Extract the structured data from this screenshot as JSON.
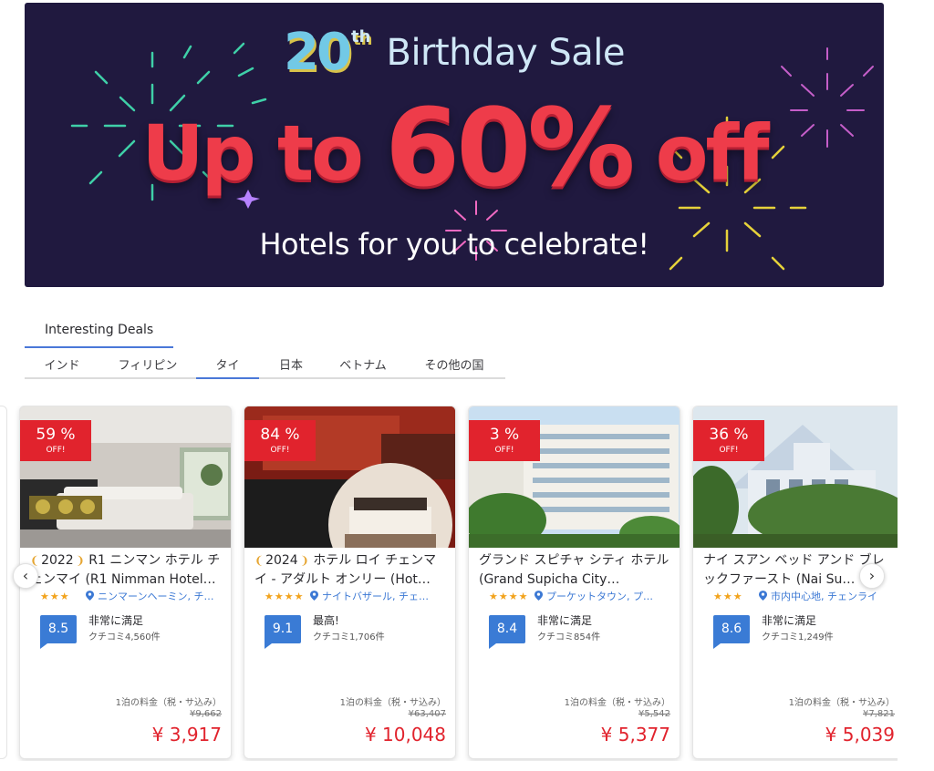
{
  "banner": {
    "number": "20",
    "suffix": "th",
    "title": "Birthday Sale",
    "headline_1": "Up to ",
    "headline_2": "60%",
    "headline_3": " off",
    "subtitle": "Hotels for you to celebrate!"
  },
  "tabs": {
    "section": "Interesting Deals",
    "countries": [
      "インド",
      "フィリピン",
      "タイ",
      "日本",
      "ベトナム",
      "その他の国"
    ],
    "active": "タイ"
  },
  "colors": {
    "accent": "#3a7bd5",
    "sale_red": "#e1232d",
    "banner_bg": "#20193f",
    "star": "#f2a31c"
  },
  "cards": [
    {
      "discount": "59 %",
      "off_label": "OFF!",
      "year": "2022",
      "name": "R1 ニンマン ホテル チェンマイ (R1 Nimman Hotel…",
      "stars": "★★★",
      "location": "ニンマーンヘーミン, チ…",
      "score": "8.5",
      "rating_label": "非常に満足",
      "review_count": "クチコミ4,560件",
      "price_label": "1泊の料金（税・サ込み）",
      "original_price": "¥9,662",
      "price": "¥ 3,917"
    },
    {
      "discount": "84 %",
      "off_label": "OFF!",
      "year": "2024",
      "name": "ホテル ロイ チェンマイ - アダルト オンリー (Hot…",
      "stars": "★★★★",
      "location": "ナイトバザール, チェ…",
      "score": "9.1",
      "rating_label": "最高!",
      "review_count": "クチコミ1,706件",
      "price_label": "1泊の料金（税・サ込み）",
      "original_price": "¥63,407",
      "price": "¥ 10,048"
    },
    {
      "discount": "3 %",
      "off_label": "OFF!",
      "year": "",
      "name": "グランド スピチャ シティ ホテル (Grand Supicha City…",
      "stars": "★★★★",
      "location": "プーケットタウン, プ…",
      "score": "8.4",
      "rating_label": "非常に満足",
      "review_count": "クチコミ854件",
      "price_label": "1泊の料金（税・サ込み）",
      "original_price": "¥5,542",
      "price": "¥ 5,377"
    },
    {
      "discount": "36 %",
      "off_label": "OFF!",
      "year": "",
      "name": "ナイ スアン ベッド アンド ブレックファースト (Nai Su…",
      "stars": "★★★",
      "location": "市内中心地, チェンライ",
      "score": "8.6",
      "rating_label": "非常に満足",
      "review_count": "クチコミ1,249件",
      "price_label": "1泊の料金（税・サ込み）",
      "original_price": "¥7,821",
      "price": "¥ 5,039"
    }
  ],
  "nav": {
    "prev_icon": "chevron-left-icon",
    "next_icon": "chevron-right-icon",
    "prev": "‹",
    "next": "›"
  }
}
